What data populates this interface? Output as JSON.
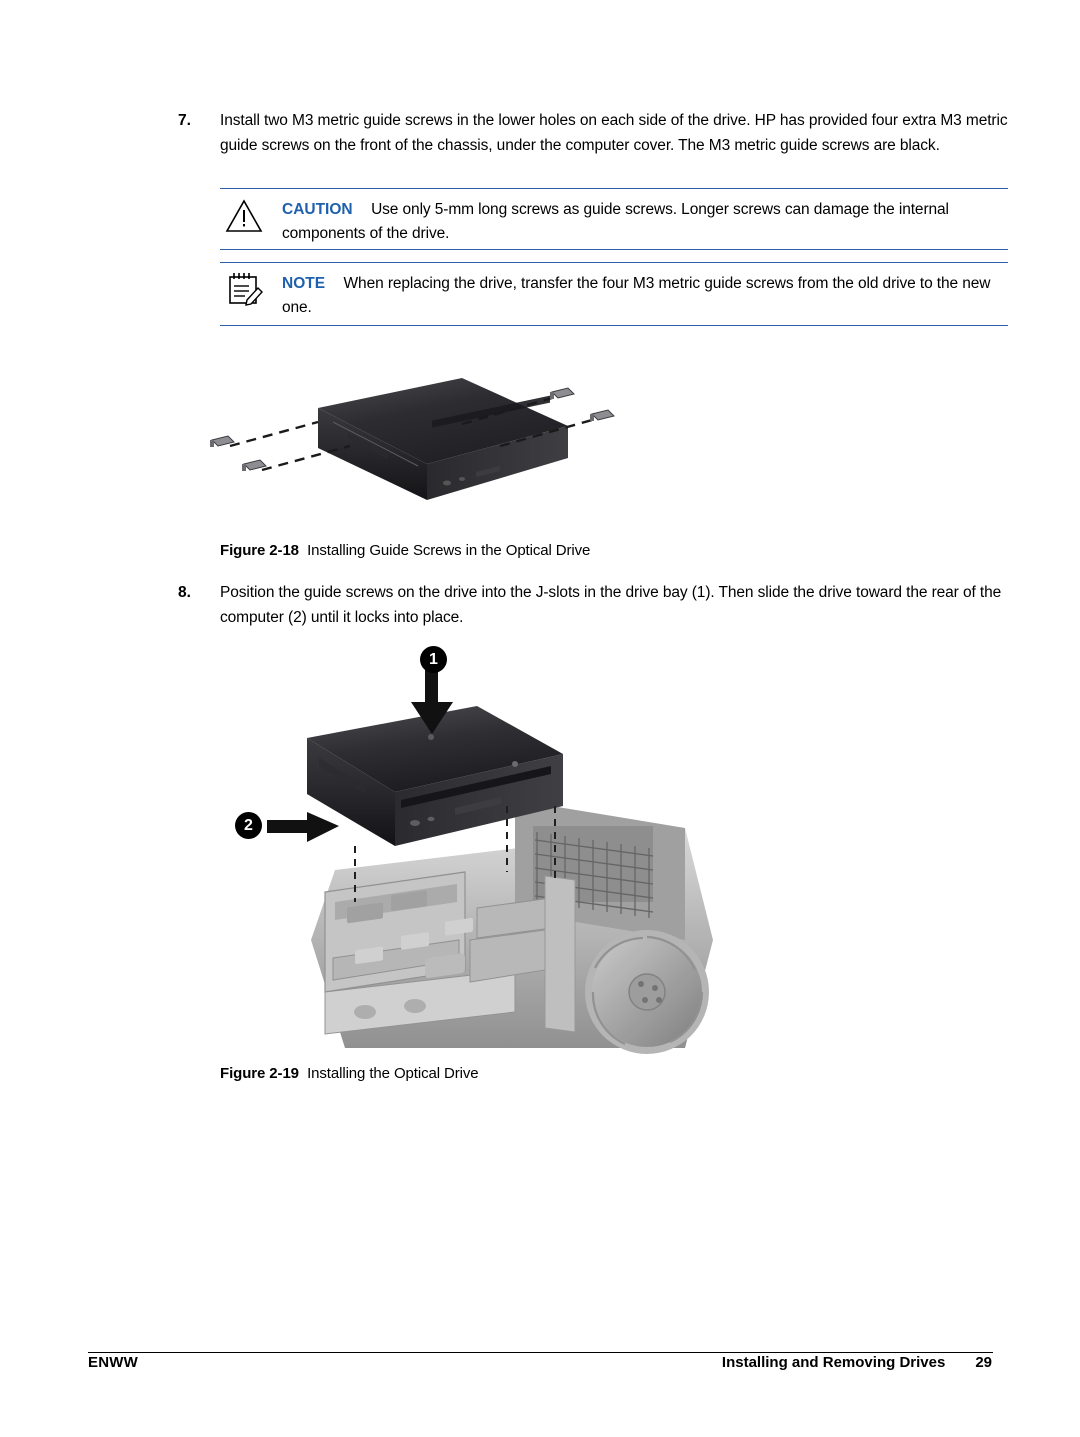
{
  "steps": [
    {
      "number": "7.",
      "text": "Install two M3 metric guide screws in the lower holes on each side of the drive. HP has provided four extra M3 metric guide screws on the front of the chassis, under the computer cover. The M3 metric guide screws are black."
    },
    {
      "number": "8.",
      "text": "Position the guide screws on the drive into the J-slots in the drive bay (1). Then slide the drive toward the rear of the computer (2) until it locks into place."
    }
  ],
  "caution": {
    "label": "CAUTION",
    "text": "Use only 5-mm long screws as guide screws. Longer screws can damage the internal components of the drive.",
    "icon": "warning-triangle-icon",
    "accent_color": "#1f60ad"
  },
  "note": {
    "label": "NOTE",
    "text": "When replacing the drive, transfer the four M3 metric guide screws from the old drive to the new one.",
    "icon": "note-pad-icon",
    "accent_color": "#1f60ad"
  },
  "figures": [
    {
      "number": "Figure 2-18",
      "title": "Installing Guide Screws in the Optical Drive",
      "image_alt": "optical-drive-with-guide-screws-illustration"
    },
    {
      "number": "Figure 2-19",
      "title": "Installing the Optical Drive",
      "image_alt": "optical-drive-into-chassis-bay-illustration",
      "callouts": [
        "1",
        "2"
      ]
    }
  ],
  "footer": {
    "left": "ENWW",
    "right": "Installing and Removing Drives",
    "page_number": "29"
  }
}
